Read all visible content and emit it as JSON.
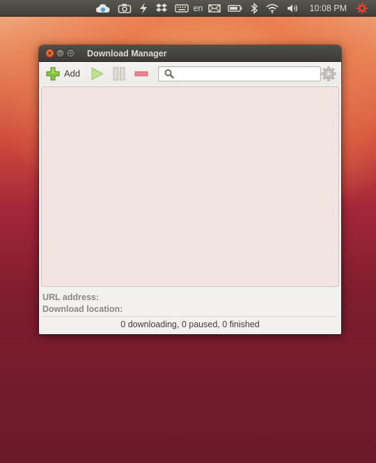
{
  "top_panel": {
    "keyboard_layout": "en",
    "clock": "10:08 PM",
    "indicators": [
      "cloud-icon",
      "camera-icon",
      "bolt-icon",
      "dropbox-icon",
      "keyboard-icon",
      "mail-icon",
      "battery-icon",
      "bluetooth-icon",
      "wifi-icon",
      "volume-icon",
      "session-gear-icon"
    ]
  },
  "window": {
    "title": "Download Manager",
    "controls": [
      "close",
      "minimize",
      "maximize"
    ]
  },
  "toolbar": {
    "add_label": "Add",
    "search_value": "",
    "search_placeholder": ""
  },
  "info": {
    "url_label": "URL address:",
    "url_value": "",
    "location_label": "Download location:",
    "location_value": ""
  },
  "status": {
    "text": "0 downloading, 0 paused, 0 finished"
  },
  "colors": {
    "accent_close": "#e45b2b",
    "add_green": "#7cb83c",
    "remove_red": "#e0707a",
    "list_bg": "#f1e4e1"
  }
}
